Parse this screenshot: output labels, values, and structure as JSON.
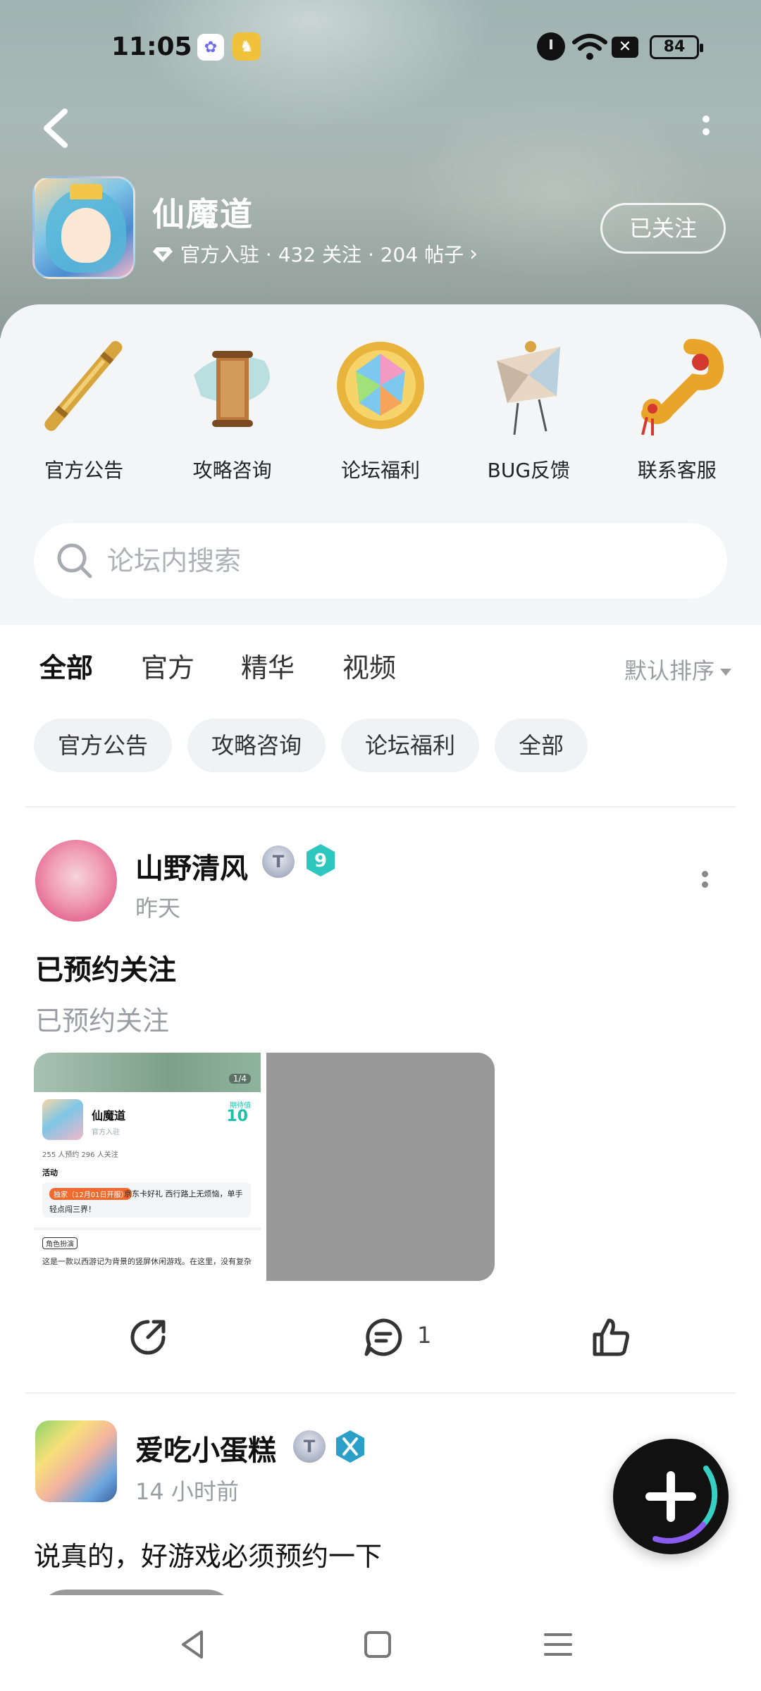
{
  "status_bar": {
    "time": "11:05",
    "battery": "84",
    "icons": [
      "app-notification-icon",
      "game-notification-icon",
      "alarm-icon",
      "wifi-icon",
      "no-sim-icon",
      "battery-icon"
    ]
  },
  "header": {
    "game_name": "仙魔道",
    "meta": "官方入驻 · 432 关注 · 204 帖子",
    "follow_label": "已关注"
  },
  "entries": [
    {
      "label": "官方公告",
      "icon": "bamboo-staff-icon"
    },
    {
      "label": "攻略咨询",
      "icon": "scroll-icon"
    },
    {
      "label": "论坛福利",
      "icon": "gem-icon"
    },
    {
      "label": "BUG反馈",
      "icon": "kite-icon"
    },
    {
      "label": "联系客服",
      "icon": "ruyi-icon"
    }
  ],
  "search": {
    "placeholder": "论坛内搜索"
  },
  "tabs": [
    "全部",
    "官方",
    "精华",
    "视频"
  ],
  "active_tab": "全部",
  "sort_label": "默认排序",
  "chips": [
    "官方公告",
    "攻略咨询",
    "论坛福利",
    "全部"
  ],
  "posts": [
    {
      "username": "山野清风",
      "level": "9",
      "time": "昨天",
      "title": "已预约关注",
      "subtitle": "已预约关注",
      "thumbnail": {
        "page_indicator": "1/4",
        "game_name": "仙魔道",
        "official": "官方入驻",
        "score_label": "期待值",
        "score": "10",
        "stats": "255 人预约    296 人关注",
        "activity_header": "活动",
        "activity_tag": "独家（12月01日开服）",
        "activity_text": "京东卡好礼 西行路上无烦恼，单手",
        "activity_text2": "轻点闯三界！",
        "role_tag": "角色扮演",
        "description": "这是一款以西游记为背景的竖屏休闲游戏。在这里，没有复杂"
      },
      "comment_count": "1"
    },
    {
      "username": "爱吃小蛋糕",
      "time": "14 小时前",
      "text": "说真的，好游戏必须预约一下"
    }
  ],
  "colors": {
    "accent": "#36d1c4",
    "level_badge": "#2ec7c0",
    "muted_text": "#9a9ea3"
  }
}
